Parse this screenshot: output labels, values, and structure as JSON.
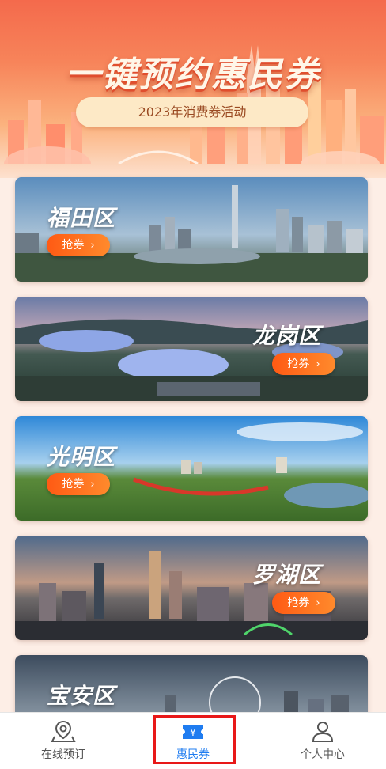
{
  "banner": {
    "title": "一键预约惠民券",
    "subtitle": "2023年消费券活动"
  },
  "districts": [
    {
      "name": "福田区",
      "button": "抢券",
      "chevron": "›"
    },
    {
      "name": "龙岗区",
      "button": "抢券",
      "chevron": "›"
    },
    {
      "name": "光明区",
      "button": "抢券",
      "chevron": "›"
    },
    {
      "name": "罗湖区",
      "button": "抢券",
      "chevron": "›"
    },
    {
      "name": "宝安区"
    }
  ],
  "tabbar": {
    "items": [
      {
        "label": "在线预订",
        "icon": "location-pin-icon"
      },
      {
        "label": "惠民券",
        "icon": "coupon-ticket-icon",
        "active": true
      },
      {
        "label": "个人中心",
        "icon": "user-profile-icon"
      }
    ]
  },
  "colors": {
    "accent": "#1f7cf0",
    "button": "#ff6a1c",
    "highlight": "#e81818"
  }
}
